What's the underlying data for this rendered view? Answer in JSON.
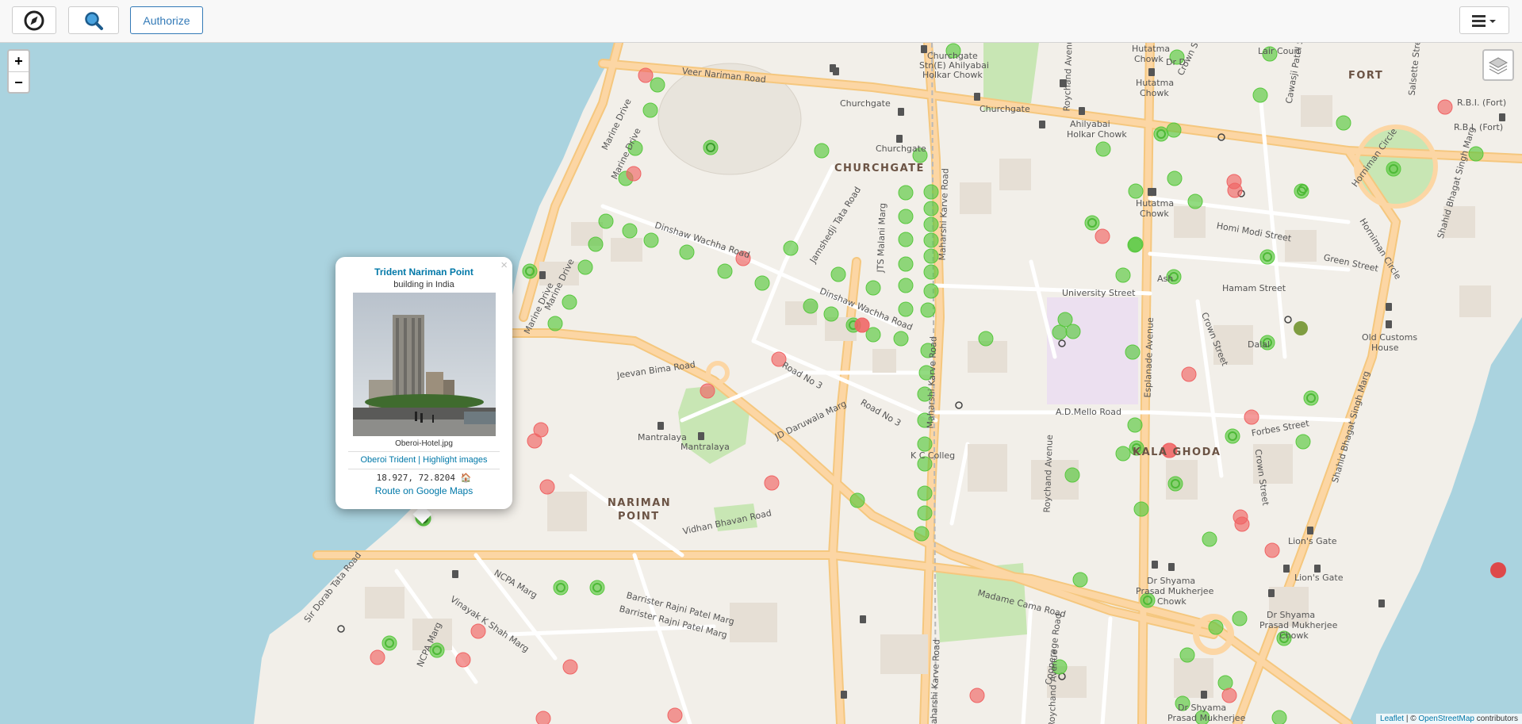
{
  "toolbar": {
    "compass_icon": "compass-icon",
    "search_icon": "search-icon",
    "authorize_label": "Authorize",
    "menu_icon": "hamburger-menu-icon"
  },
  "map": {
    "zoom_in": "+",
    "zoom_out": "−",
    "labels": {
      "churchgate_district": "CHURCHGATE",
      "nariman_point_1": "NARIMAN",
      "nariman_point_2": "POINT",
      "kala_ghoda": "KALA GHODA",
      "fort": "FORT",
      "veer_nariman": "Veer Nariman Road",
      "churchgate_station": "Churchgate",
      "churchgate_2": "Churchgate",
      "churchgate_3": "Churchgate",
      "churchgate_stn": "Churchgate",
      "churchgate_stn2": "Stn(E) Ahilyabai",
      "churchgate_stn3": "Holkar Chowk",
      "hutatma_1": "Hutatma",
      "hutatma_2": "Chowk",
      "hutatma_3": "Hutatma",
      "hutatma_4": "Chowk",
      "hutatma_5": "Hutatma",
      "hutatma_6": "Chowk",
      "ahilyabai_1": "Ahilyabai",
      "ahilyabai_2": "Holkar Chowk",
      "dinshaw_1": "Dinshaw Wachha Road",
      "dinshaw_2": "Dinshaw Wachha Road",
      "jamshedji": "Jamshedji Tata Road",
      "jts": "JTS Malani Marg",
      "maharshi_1": "Maharshi Karve Road",
      "maharshi_2": "Maharshi Karve Road",
      "maharshi_3": "Maharshi Karve Road",
      "marine_1": "Marine Drive",
      "marine_2": "Marine Drive",
      "marine_3": "Marine Drive",
      "marine_4": "Marine Drive",
      "jeevan_bima": "Jeevan Bima Road",
      "road_no3_a": "Road No 3",
      "road_no3_b": "Road No 3",
      "jd_daruwala": "JD Daruwala Marg",
      "mantralaya_1": "Mantralaya",
      "mantralaya_2": "Mantralaya",
      "kc_college": "K C Colleg",
      "vidhan": "Vidhan Bhavan Road",
      "ncpa": "NCPA Marg",
      "vinayak": "Vinayak K Shah Marg",
      "barrister_1": "Barrister Rajni Patel Marg",
      "barrister_2": "Barrister Rajni Patel Marg",
      "sir_dorab": "Sir Dorab Tata Road",
      "ncpa_2": "NCPA Marg",
      "roychand_1": "Roychand Avenue",
      "roychand_2": "Roychand Avenue",
      "roychand_3": "Roychand Avenue",
      "university": "University Street",
      "esplanade": "Esplanade Avenue",
      "ad_mello": "A.D.Mello Road",
      "homi_modi": "Homi Modi Street",
      "hamam": "Hamam Street",
      "green_st": "Green Street",
      "dalal": "Dalal",
      "ash": "Ash",
      "crown_1": "Crown Street",
      "crown_2": "Crown Street",
      "crown_3": "Crown Street",
      "forbes": "Forbes Street",
      "old_customs_1": "Old Customs",
      "old_customs_2": "House",
      "shahid_1": "Shahid Bhagat Singh Marg",
      "shahid_2": "Shahid Bhagat Singh Marg",
      "horniman_1": "Horniman Circle",
      "horniman_2": "Horniman Circle",
      "rbi_1": "R.B.I. (Fort)",
      "rbi_2": "R.B.I. (Fort)",
      "lions_1": "Lion's Gate",
      "lions_2": "Lion's Gate",
      "dr_shyama_1": "Dr Shyama",
      "dr_shyama_2": "Prasad Mukherjee",
      "dr_shyama_3": "Chowk",
      "dr_shyama_4": "Dr Shyama",
      "dr_shyama_5": "Prasad Mukherjee",
      "dr_shyama_6": "Chowk",
      "dr_shyama_7": "Dr Shyama",
      "dr_shyama_8": "Prasad Mukherjee",
      "madame_cama": "Madame Cama Road",
      "cooperage": "Cooperage Road",
      "lair": "Lair Court",
      "cawasji": "Cawasji Patel Street",
      "salsette": "Salsette Street",
      "dr_d": "Dr D"
    }
  },
  "popup": {
    "close": "×",
    "title": "Trident Nariman Point",
    "subtitle": "building in India",
    "filename": "Oberoi-Hotel.jpg",
    "link_1": "Oberoi Trident",
    "separator": "|",
    "link_2": "Highlight images",
    "coords": "18.927, 72.8204",
    "route": "Route on Google Maps"
  },
  "attribution": {
    "leaflet": "Leaflet",
    "sep": "| ©",
    "osm": "OpenStreetMap",
    "contributors": "contributors"
  },
  "colors": {
    "water": "#aad3df",
    "land": "#f2efe9",
    "road_major": "#fcd6a4",
    "road_minor": "#ffffff",
    "green_marker": "#58c83e",
    "red_marker": "#f06464",
    "park": "#c8e6b4",
    "link": "#0078a8"
  }
}
